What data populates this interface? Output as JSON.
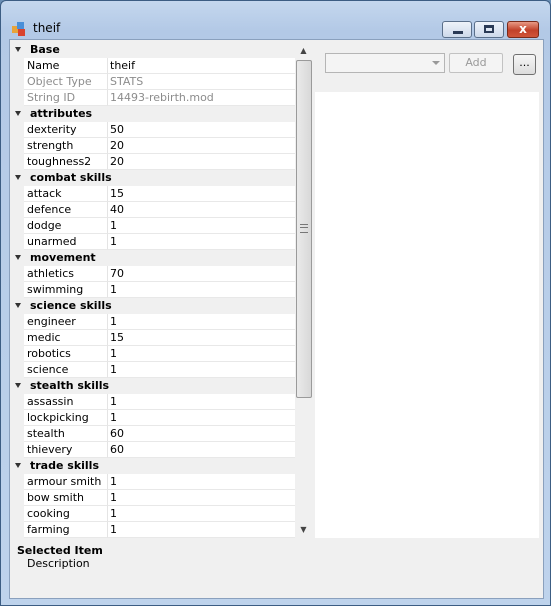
{
  "window": {
    "title": "theif",
    "buttons": {
      "minimize": "minimize",
      "maximize": "maximize",
      "close": "x"
    }
  },
  "grid": {
    "categories": [
      {
        "label": "Base",
        "props": [
          {
            "name": "Name",
            "value": "theif",
            "readonly": false
          },
          {
            "name": "Object Type",
            "value": "STATS",
            "readonly": true
          },
          {
            "name": "String ID",
            "value": "14493-rebirth.mod",
            "readonly": true
          }
        ]
      },
      {
        "label": "attributes",
        "props": [
          {
            "name": "dexterity",
            "value": "50"
          },
          {
            "name": "strength",
            "value": "20"
          },
          {
            "name": "toughness2",
            "value": "20"
          }
        ]
      },
      {
        "label": "combat skills",
        "props": [
          {
            "name": "attack",
            "value": "15"
          },
          {
            "name": "defence",
            "value": "40"
          },
          {
            "name": "dodge",
            "value": "1"
          },
          {
            "name": "unarmed",
            "value": "1"
          }
        ]
      },
      {
        "label": "movement",
        "props": [
          {
            "name": "athletics",
            "value": "70"
          },
          {
            "name": "swimming",
            "value": "1"
          }
        ]
      },
      {
        "label": "science skills",
        "props": [
          {
            "name": "engineer",
            "value": "1"
          },
          {
            "name": "medic",
            "value": "15"
          },
          {
            "name": "robotics",
            "value": "1"
          },
          {
            "name": "science",
            "value": "1"
          }
        ]
      },
      {
        "label": "stealth skills",
        "props": [
          {
            "name": "assassin",
            "value": "1"
          },
          {
            "name": "lockpicking",
            "value": "1"
          },
          {
            "name": "stealth",
            "value": "60"
          },
          {
            "name": "thievery",
            "value": "60"
          }
        ]
      },
      {
        "label": "trade skills",
        "props": [
          {
            "name": "armour smith",
            "value": "1"
          },
          {
            "name": "bow smith",
            "value": "1"
          },
          {
            "name": "cooking",
            "value": "1"
          },
          {
            "name": "farming",
            "value": "1"
          }
        ]
      }
    ]
  },
  "description": {
    "title": "Selected Item",
    "text": "Description"
  },
  "toolbar": {
    "combo_value": "",
    "add_label": "Add",
    "more_label": "..."
  },
  "colors": {
    "title_bar": "#bed3ec",
    "close_button": "#c2412a",
    "category_bg": "#f0f0f0"
  }
}
